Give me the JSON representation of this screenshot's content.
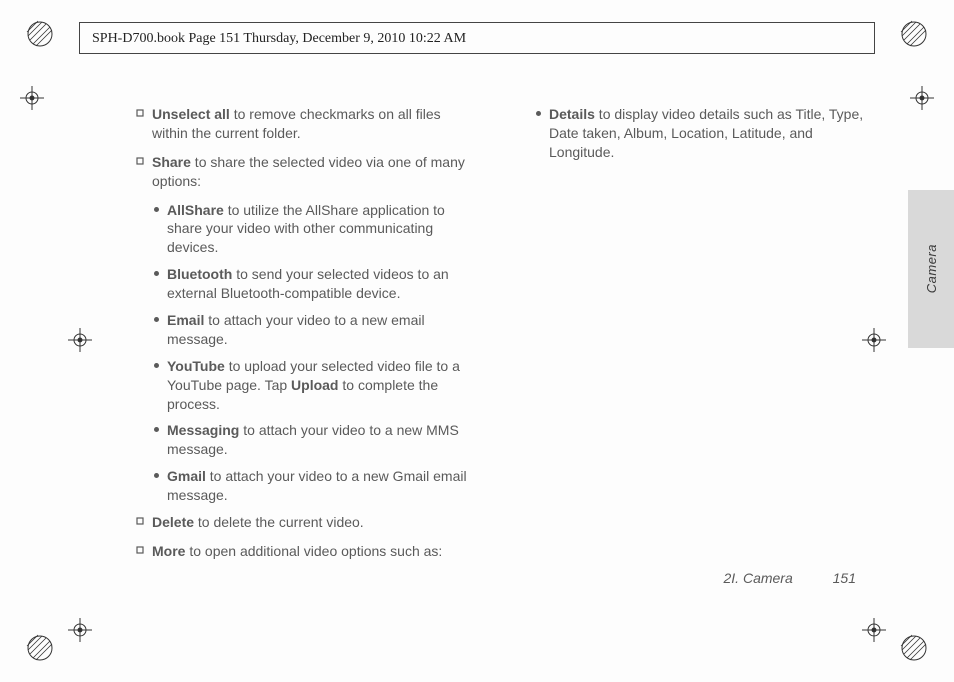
{
  "header": {
    "text": "SPH-D700.book  Page 151  Thursday, December 9, 2010  10:22 AM"
  },
  "left": {
    "unselect": {
      "b": "Unselect all",
      "t": " to remove checkmarks on all files within the current folder."
    },
    "share": {
      "b": "Share",
      "t": " to share the selected video via one of many options:"
    },
    "allshare": {
      "b": "AllShare",
      "t": " to utilize the AllShare application to share your video with other communicating devices."
    },
    "bluetooth": {
      "b": "Bluetooth",
      "t": " to send your selected videos to an external Bluetooth-compatible device."
    },
    "email": {
      "b": "Email",
      "t": " to attach your video to a new email message."
    },
    "youtube": {
      "b": "YouTube",
      "t1": " to upload your selected video file to a YouTube page. Tap ",
      "b2": "Upload",
      "t2": " to complete the process."
    },
    "messaging": {
      "b": "Messaging",
      "t": " to attach your video to a new MMS message."
    },
    "gmail": {
      "b": "Gmail",
      "t": " to attach your video to a new Gmail email message."
    },
    "delete": {
      "b": "Delete",
      "t": " to delete the current video."
    },
    "more": {
      "b": "More",
      "t": " to open additional video options such as:"
    }
  },
  "right": {
    "details": {
      "b": "Details",
      "t": " to display video details such as Title, Type, Date taken, Album, Location, Latitude, and Longitude."
    }
  },
  "sidetab": {
    "label": "Camera"
  },
  "footer": {
    "section": "2I. Camera",
    "page": "151"
  }
}
